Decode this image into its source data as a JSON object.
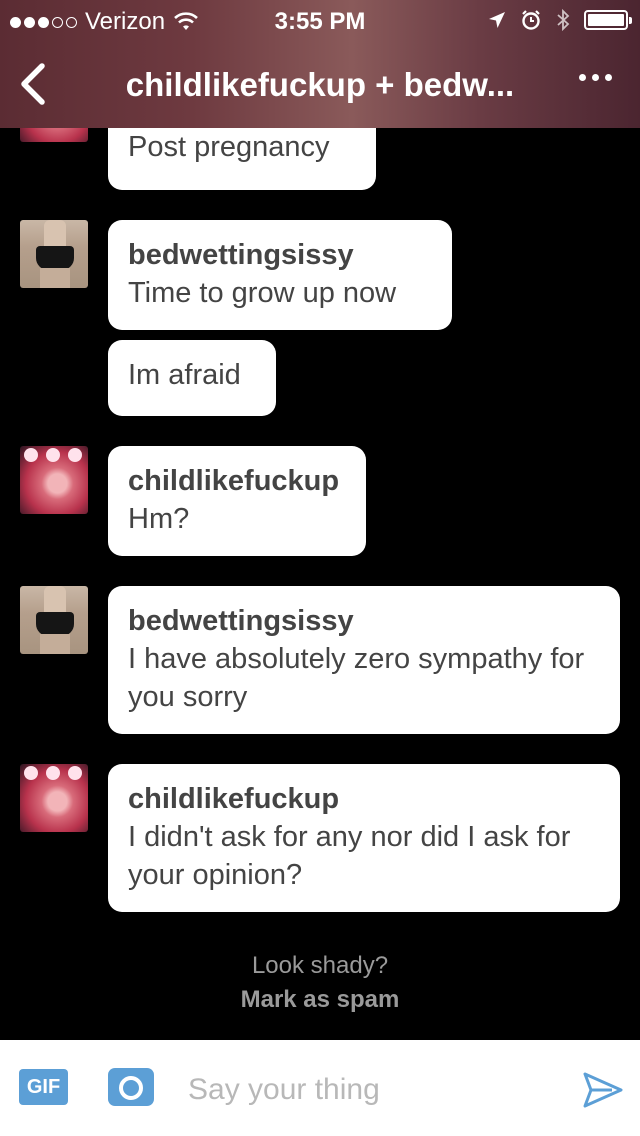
{
  "status_bar": {
    "carrier": "Verizon",
    "time": "3:55 PM"
  },
  "header": {
    "title": "childlikefuckup + bedw..."
  },
  "messages": [
    {
      "author": "",
      "text": "Post pregnancy"
    },
    {
      "author": "bedwettingsissy",
      "text": "Time to grow up now"
    },
    {
      "author": "",
      "text": "Im afraid"
    },
    {
      "author": "childlikefuckup",
      "text": "Hm?"
    },
    {
      "author": "bedwettingsissy",
      "text": "I have absolutely zero sympathy for you sorry"
    },
    {
      "author": "childlikefuckup",
      "text": "I didn't ask for any nor did I ask for your opinion?"
    }
  ],
  "spam_notice": {
    "question": "Look shady?",
    "action": "Mark as spam"
  },
  "composer": {
    "gif_label": "GIF",
    "placeholder": "Say your thing"
  },
  "colors": {
    "accent": "#5c9fd6",
    "bubble": "#ffffff",
    "background": "#000000"
  },
  "icons": [
    "wifi-icon",
    "location-arrow-icon",
    "alarm-icon",
    "bluetooth-icon",
    "battery-icon",
    "back-chevron-icon",
    "more-icon",
    "camera-icon",
    "send-icon"
  ]
}
